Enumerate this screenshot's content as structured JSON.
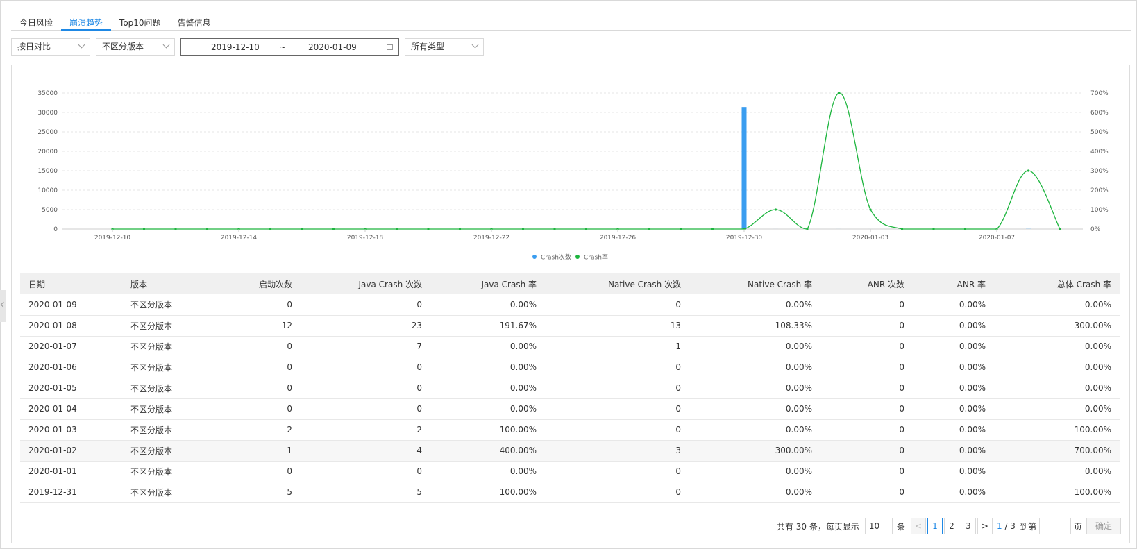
{
  "tabs": [
    {
      "label": "今日风险",
      "active": false
    },
    {
      "label": "崩溃趋势",
      "active": true
    },
    {
      "label": "Top10问题",
      "active": false
    },
    {
      "label": "告警信息",
      "active": false
    }
  ],
  "filters": {
    "compare": "按日对比",
    "version": "不区分版本",
    "date_start": "2019-12-10",
    "date_sep": "~",
    "date_end": "2020-01-09",
    "type": "所有类型"
  },
  "chart_data": {
    "type": "bar+line",
    "x": [
      "2019-12-10",
      "2019-12-11",
      "2019-12-12",
      "2019-12-13",
      "2019-12-14",
      "2019-12-15",
      "2019-12-16",
      "2019-12-17",
      "2019-12-18",
      "2019-12-19",
      "2019-12-20",
      "2019-12-21",
      "2019-12-22",
      "2019-12-23",
      "2019-12-24",
      "2019-12-25",
      "2019-12-26",
      "2019-12-27",
      "2019-12-28",
      "2019-12-29",
      "2019-12-30",
      "2019-12-31",
      "2020-01-01",
      "2020-01-02",
      "2020-01-03",
      "2020-01-04",
      "2020-01-05",
      "2020-01-06",
      "2020-01-07",
      "2020-01-08",
      "2020-01-09"
    ],
    "xticks": [
      "2019-12-10",
      "2019-12-14",
      "2019-12-18",
      "2019-12-22",
      "2019-12-26",
      "2019-12-30",
      "2020-01-03",
      "2020-01-07"
    ],
    "series": [
      {
        "name": "Crash次数",
        "axis": "left",
        "kind": "bar",
        "color": "#3a9df0",
        "values": [
          0,
          0,
          0,
          0,
          0,
          0,
          0,
          0,
          0,
          0,
          0,
          0,
          0,
          0,
          0,
          0,
          0,
          0,
          0,
          0,
          31400,
          5,
          0,
          7,
          2,
          0,
          0,
          0,
          1,
          36,
          0
        ]
      },
      {
        "name": "Crash率",
        "axis": "right",
        "kind": "line",
        "color": "#1db53e",
        "values": [
          0,
          0,
          0,
          0,
          0,
          0,
          0,
          0,
          0,
          0,
          0,
          0,
          0,
          0,
          0,
          0,
          0,
          0,
          0,
          0,
          0,
          100,
          0,
          700,
          100,
          0,
          0,
          0,
          0,
          300,
          0
        ]
      }
    ],
    "yleft": {
      "min": 0,
      "max": 35000,
      "ticks": [
        "0",
        "5000",
        "10000",
        "15000",
        "20000",
        "25000",
        "30000",
        "35000"
      ]
    },
    "yright": {
      "min": 0,
      "max": 700,
      "ticks": [
        "0%",
        "100%",
        "200%",
        "300%",
        "400%",
        "500%",
        "600%",
        "700%"
      ]
    },
    "grid": true,
    "legend": "bottom-center"
  },
  "table": {
    "headers": [
      "日期",
      "版本",
      "启动次数",
      "Java Crash 次数",
      "Java Crash 率",
      "Native Crash 次数",
      "Native Crash 率",
      "ANR 次数",
      "ANR 率",
      "总体 Crash 率"
    ],
    "rows": [
      [
        "2020-01-09",
        "不区分版本",
        "0",
        "0",
        "0.00%",
        "0",
        "0.00%",
        "0",
        "0.00%",
        "0.00%"
      ],
      [
        "2020-01-08",
        "不区分版本",
        "12",
        "23",
        "191.67%",
        "13",
        "108.33%",
        "0",
        "0.00%",
        "300.00%"
      ],
      [
        "2020-01-07",
        "不区分版本",
        "0",
        "7",
        "0.00%",
        "1",
        "0.00%",
        "0",
        "0.00%",
        "0.00%"
      ],
      [
        "2020-01-06",
        "不区分版本",
        "0",
        "0",
        "0.00%",
        "0",
        "0.00%",
        "0",
        "0.00%",
        "0.00%"
      ],
      [
        "2020-01-05",
        "不区分版本",
        "0",
        "0",
        "0.00%",
        "0",
        "0.00%",
        "0",
        "0.00%",
        "0.00%"
      ],
      [
        "2020-01-04",
        "不区分版本",
        "0",
        "0",
        "0.00%",
        "0",
        "0.00%",
        "0",
        "0.00%",
        "0.00%"
      ],
      [
        "2020-01-03",
        "不区分版本",
        "2",
        "2",
        "100.00%",
        "0",
        "0.00%",
        "0",
        "0.00%",
        "100.00%"
      ],
      [
        "2020-01-02",
        "不区分版本",
        "1",
        "4",
        "400.00%",
        "3",
        "300.00%",
        "0",
        "0.00%",
        "700.00%"
      ],
      [
        "2020-01-01",
        "不区分版本",
        "0",
        "0",
        "0.00%",
        "0",
        "0.00%",
        "0",
        "0.00%",
        "0.00%"
      ],
      [
        "2019-12-31",
        "不区分版本",
        "5",
        "5",
        "100.00%",
        "0",
        "0.00%",
        "0",
        "0.00%",
        "100.00%"
      ]
    ],
    "highlighted_row": 7
  },
  "pager": {
    "total_text": "共有 30 条，每页显示",
    "page_size": "10",
    "unit": "条",
    "prev": "<",
    "pages": [
      "1",
      "2",
      "3"
    ],
    "current": "1",
    "next": ">",
    "page_info_current": "1",
    "page_info_total": "/ 3",
    "goto_text": "到第",
    "page_unit": "页",
    "confirm": "确定"
  }
}
